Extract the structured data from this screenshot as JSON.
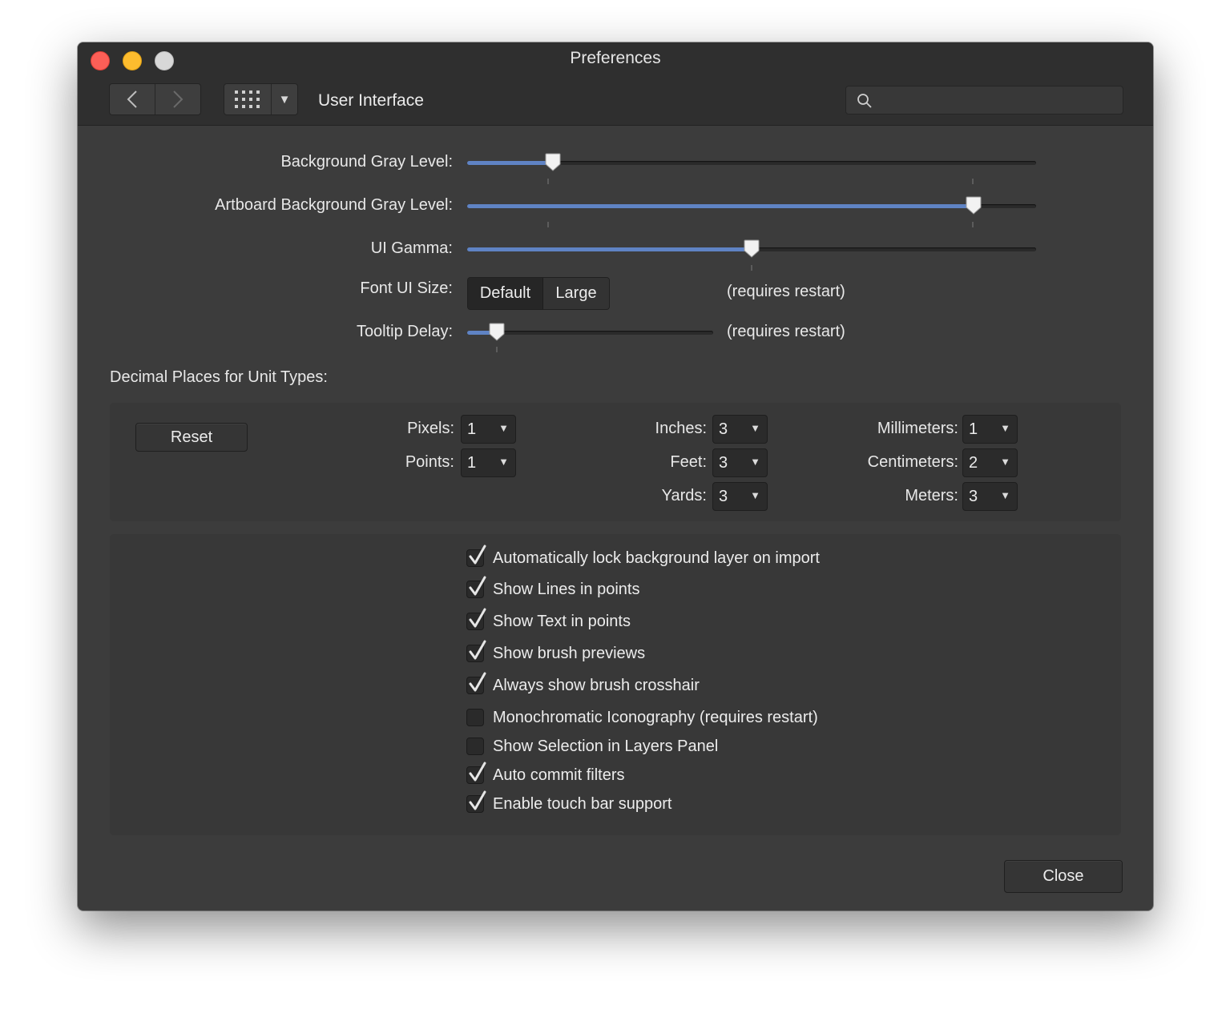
{
  "window": {
    "title": "Preferences"
  },
  "toolbar": {
    "section": "User Interface",
    "search_placeholder": "",
    "search_value": ""
  },
  "icons": {
    "back": "chevron-left-icon",
    "forward": "chevron-right-icon",
    "grid": "grid-icon",
    "dropdown": "triangle-down-icon",
    "search": "magnifier-icon",
    "check": "checkmark-icon"
  },
  "colors": {
    "window_bg": "#3c3c3c",
    "titlebar_bg": "#2f2f2f",
    "slider_fill": "#5f83c4",
    "close_light": "#fc5f57",
    "minimize_light": "#fdbc2e",
    "zoom_light": "#d8d8d8"
  },
  "sliders": {
    "background_gray": {
      "label": "Background Gray Level:",
      "value": 0.15
    },
    "artboard_gray": {
      "label": "Artboard Background Gray Level:",
      "value": 0.89
    },
    "ui_gamma": {
      "label": "UI Gamma:",
      "value": 0.5
    },
    "tooltip_delay": {
      "label": "Tooltip Delay:",
      "value": 0.12,
      "note": "(requires restart)"
    }
  },
  "font_ui_size": {
    "label": "Font UI Size:",
    "options": [
      "Default",
      "Large"
    ],
    "selected": "Default",
    "note": "(requires restart)"
  },
  "decimal": {
    "title": "Decimal Places for Unit Types:",
    "reset_label": "Reset",
    "units": {
      "pixels": {
        "label": "Pixels:",
        "value": "1"
      },
      "points": {
        "label": "Points:",
        "value": "1"
      },
      "inches": {
        "label": "Inches:",
        "value": "3"
      },
      "feet": {
        "label": "Feet:",
        "value": "3"
      },
      "yards": {
        "label": "Yards:",
        "value": "3"
      },
      "millimeters": {
        "label": "Millimeters:",
        "value": "1"
      },
      "centimeters": {
        "label": "Centimeters:",
        "value": "2"
      },
      "meters": {
        "label": "Meters:",
        "value": "3"
      }
    }
  },
  "options": [
    {
      "label": "Automatically lock background layer on import",
      "checked": true
    },
    {
      "label": "Show Lines in points",
      "checked": true
    },
    {
      "label": "Show Text in points",
      "checked": true
    },
    {
      "label": "Show brush previews",
      "checked": true
    },
    {
      "label": "Always show brush crosshair",
      "checked": true
    },
    {
      "label": "Monochromatic Iconography (requires restart)",
      "checked": false
    },
    {
      "label": "Show Selection in Layers Panel",
      "checked": false
    },
    {
      "label": "Auto commit filters",
      "checked": true
    },
    {
      "label": "Enable touch bar support",
      "checked": true
    }
  ],
  "footer": {
    "close_label": "Close"
  }
}
